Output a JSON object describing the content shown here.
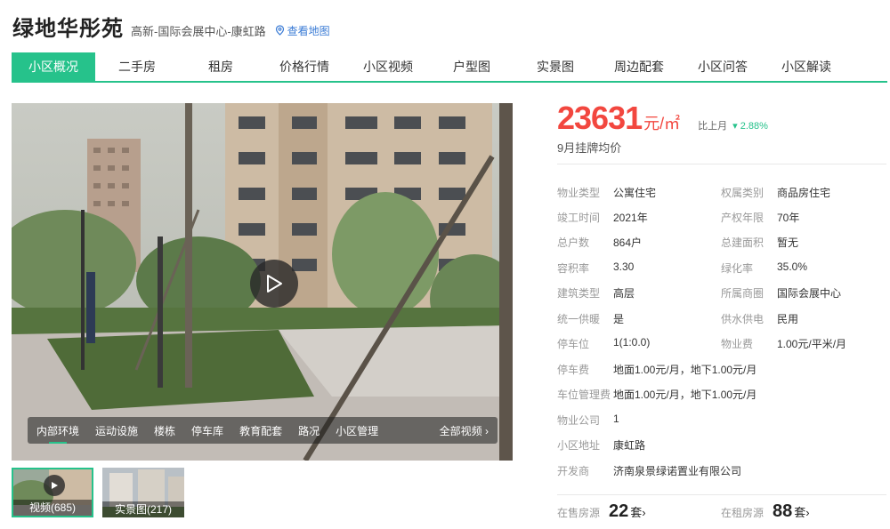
{
  "header": {
    "title": "绿地华彤苑",
    "location": "高新-国际会展中心-康虹路",
    "map_link": "查看地图"
  },
  "tabs": [
    "小区概况",
    "二手房",
    "租房",
    "价格行情",
    "小区视频",
    "户型图",
    "实景图",
    "周边配套",
    "小区问答",
    "小区解读"
  ],
  "media": {
    "tabs": [
      "内部环境",
      "运动设施",
      "楼栋",
      "停车库",
      "教育配套",
      "路况",
      "小区管理"
    ],
    "all_videos": "全部视频 ›",
    "thumbs": [
      {
        "label": "视频(685)"
      },
      {
        "label": "实景图(217)"
      }
    ]
  },
  "price": {
    "value": "23631",
    "unit": "元/㎡",
    "mom_label": "比上月",
    "mom_value": "▾ 2.88%",
    "caption": "9月挂牌均价"
  },
  "details": [
    {
      "label": "物业类型",
      "value": "公寓住宅"
    },
    {
      "label": "权属类别",
      "value": "商品房住宅"
    },
    {
      "label": "竣工时间",
      "value": "2021年"
    },
    {
      "label": "产权年限",
      "value": "70年"
    },
    {
      "label": "总户数",
      "value": "864户"
    },
    {
      "label": "总建面积",
      "value": "暂无"
    },
    {
      "label": "容积率",
      "value": "3.30"
    },
    {
      "label": "绿化率",
      "value": "35.0%"
    },
    {
      "label": "建筑类型",
      "value": "高层"
    },
    {
      "label": "所属商圈",
      "value": "国际会展中心"
    },
    {
      "label": "统一供暖",
      "value": "是"
    },
    {
      "label": "供水供电",
      "value": "民用"
    },
    {
      "label": "停车位",
      "value": "1(1:0.0)"
    },
    {
      "label": "物业费",
      "value": "1.00元/平米/月"
    },
    {
      "label": "停车费",
      "value": "地面1.00元/月，地下1.00元/月"
    },
    {
      "label": "车位管理费",
      "value": "地面1.00元/月，地下1.00元/月"
    },
    {
      "label": "物业公司",
      "value": "1"
    },
    {
      "label": "小区地址",
      "value": "康虹路"
    },
    {
      "label": "开发商",
      "value": "济南泉景绿诺置业有限公司"
    }
  ],
  "stats": {
    "sale_label": "在售房源",
    "sale_count": "22",
    "sale_unit": "套›",
    "rent_label": "在租房源",
    "rent_count": "88",
    "rent_unit": "套›"
  },
  "colors": {
    "accent": "#26c28b",
    "price": "#f2473f",
    "link": "#3a7bd5"
  }
}
